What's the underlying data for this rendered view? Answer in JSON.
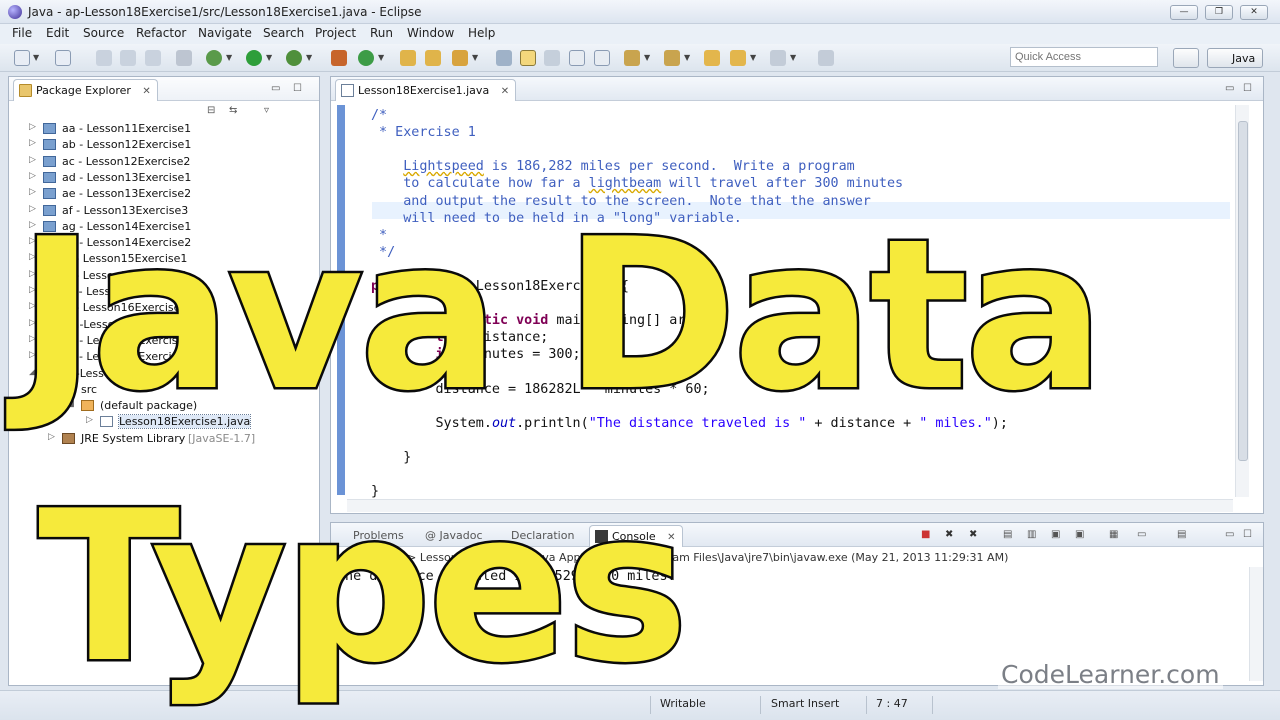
{
  "window": {
    "title": "Java - ap-Lesson18Exercise1/src/Lesson18Exercise1.java - Eclipse",
    "controls": [
      "—",
      "❐",
      "✕"
    ]
  },
  "menu": [
    "File",
    "Edit",
    "Source",
    "Refactor",
    "Navigate",
    "Search",
    "Project",
    "Run",
    "Window",
    "Help"
  ],
  "toolbar": {
    "quick_access_placeholder": "Quick Access",
    "perspective": "Java"
  },
  "package_explorer": {
    "tab_label": "Package Explorer",
    "items": [
      {
        "label": "aa - Lesson11Exercise1",
        "indent": 0,
        "icon": "project-icon",
        "expanded": false
      },
      {
        "label": "ab - Lesson12Exercise1",
        "indent": 0,
        "icon": "project-icon",
        "expanded": false
      },
      {
        "label": "ac - Lesson12Exercise2",
        "indent": 0,
        "icon": "project-icon",
        "expanded": false
      },
      {
        "label": "ad - Lesson13Exercise1",
        "indent": 0,
        "icon": "project-icon",
        "expanded": false
      },
      {
        "label": "ae - Lesson13Exercise2",
        "indent": 0,
        "icon": "project-icon",
        "expanded": false
      },
      {
        "label": "af - Lesson13Exercise3",
        "indent": 0,
        "icon": "project-icon",
        "expanded": false
      },
      {
        "label": "ag - Lesson14Exercise1",
        "indent": 0,
        "icon": "project-icon",
        "expanded": false
      },
      {
        "label": "ah - Lesson14Exercise2",
        "indent": 0,
        "icon": "project-icon",
        "expanded": false
      },
      {
        "label": "ai - Lesson15Exercise1",
        "indent": 0,
        "icon": "project-icon",
        "expanded": false
      },
      {
        "label": "aj - Lesson15Exercise2",
        "indent": 0,
        "icon": "project-icon",
        "expanded": false
      },
      {
        "label": "ak - Lesson16Exercise1",
        "indent": 0,
        "icon": "project-icon",
        "expanded": false
      },
      {
        "label": "al - Lesson16Exercise2",
        "indent": 0,
        "icon": "project-icon",
        "expanded": false
      },
      {
        "label": "am-Lesson17Exercise1",
        "indent": 0,
        "icon": "project-icon",
        "expanded": false
      },
      {
        "label": "an - Lesson17Exercise2",
        "indent": 0,
        "icon": "project-icon",
        "expanded": false
      },
      {
        "label": "ao - Lesson17Exercise3",
        "indent": 0,
        "icon": "project-icon",
        "expanded": false
      },
      {
        "label": "ap-Lesson18Exercise1",
        "indent": 0,
        "icon": "project-icon",
        "expanded": true
      },
      {
        "label": "src",
        "indent": 1,
        "icon": "folder-icon",
        "expanded": true
      },
      {
        "label": "(default package)",
        "indent": 2,
        "icon": "package-icon",
        "expanded": true
      },
      {
        "label": "Lesson18Exercise1.java",
        "indent": 3,
        "icon": "java-file-icon",
        "expanded": false
      },
      {
        "label": "JRE System Library",
        "suffix": "[JavaSE-1.7]",
        "indent": 1,
        "icon": "library-icon",
        "expanded": false
      }
    ]
  },
  "editor": {
    "tab_label": "Lesson18Exercise1.java",
    "lines": [
      [
        [
          "cmt",
          "/*"
        ]
      ],
      [
        [
          "cmt",
          " * Exercise 1"
        ]
      ],
      [
        [
          "cmt",
          ""
        ]
      ],
      [
        [
          "cmt",
          "    "
        ],
        [
          "cmt sq",
          "Lightspeed"
        ],
        [
          "cmt",
          " is 186,282 miles per second.  Write a program"
        ]
      ],
      [
        [
          "cmt",
          "    to calculate how far a "
        ],
        [
          "cmt sq",
          "lightbeam"
        ],
        [
          "cmt",
          " will travel after 300 minutes"
        ]
      ],
      [
        [
          "cmt",
          "    and output the result to the screen.  Note that the answer"
        ]
      ],
      [
        [
          "cmt",
          "    will need to be held in a \"long\" variable."
        ]
      ],
      [
        [
          "cmt",
          " *"
        ]
      ],
      [
        [
          "cmt",
          " */"
        ]
      ],
      [
        [
          "",
          ""
        ]
      ],
      [
        [
          "kw",
          "public"
        ],
        [
          "",
          " "
        ],
        [
          "kw",
          "class"
        ],
        [
          "",
          " Lesson18Exercise1 {"
        ]
      ],
      [
        [
          "",
          ""
        ]
      ],
      [
        [
          "",
          "    "
        ],
        [
          "kw",
          "public"
        ],
        [
          "",
          " "
        ],
        [
          "kw",
          "static"
        ],
        [
          "",
          " "
        ],
        [
          "kw",
          "void"
        ],
        [
          "",
          " main(String[] args) {"
        ]
      ],
      [
        [
          "",
          "        "
        ],
        [
          "kw",
          "long"
        ],
        [
          "",
          " distance;"
        ]
      ],
      [
        [
          "",
          "        "
        ],
        [
          "kw",
          "int"
        ],
        [
          "",
          " minutes = 300;"
        ]
      ],
      [
        [
          "",
          ""
        ]
      ],
      [
        [
          "",
          "        distance = 186282L * minutes * 60;"
        ]
      ],
      [
        [
          "",
          ""
        ]
      ],
      [
        [
          "",
          "        System."
        ],
        [
          "it",
          "out"
        ],
        [
          "",
          ".println("
        ],
        [
          "str",
          "\"The distance traveled is \""
        ],
        [
          "",
          " + distance + "
        ],
        [
          "str",
          "\" miles.\""
        ],
        [
          "",
          ");"
        ]
      ],
      [
        [
          "",
          ""
        ]
      ],
      [
        [
          "",
          "    }"
        ]
      ],
      [
        [
          "",
          ""
        ]
      ],
      [
        [
          "",
          "}"
        ]
      ]
    ]
  },
  "bottom_panel": {
    "tabs": [
      "Problems",
      "@ Javadoc",
      "Declaration",
      "Console"
    ],
    "header": "<terminated> Lesson18Exercise1 [Java Application] C:\\Program Files\\Java\\jre7\\bin\\javaw.exe (May 21, 2013 11:29:31 AM)",
    "output": "The distance traveled is 3352928400 miles."
  },
  "status": {
    "writable": "Writable",
    "insert_mode": "Smart Insert",
    "position": "7 : 47"
  },
  "overlay": {
    "line1": "Java Data",
    "line2": "Types",
    "text_color": "#f6ea3b"
  },
  "watermark": "CodeLearner.com"
}
